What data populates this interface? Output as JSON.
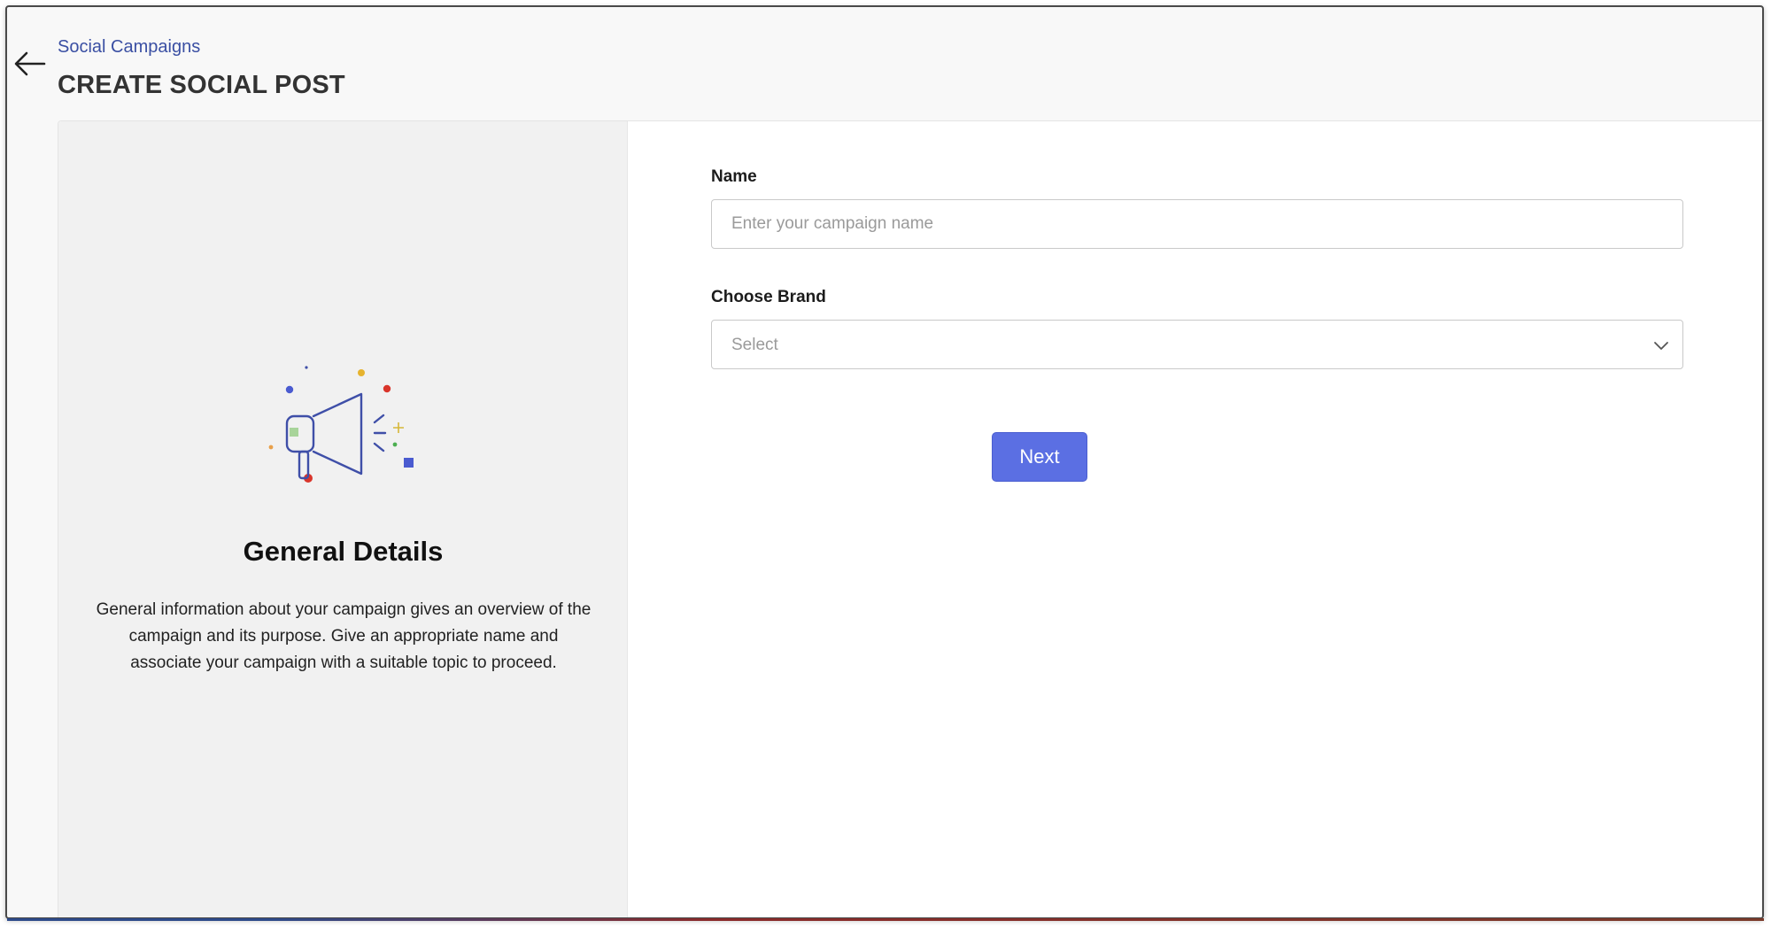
{
  "header": {
    "breadcrumb": "Social Campaigns",
    "title": "CREATE SOCIAL POST",
    "back_icon": "arrow-left-icon"
  },
  "left_panel": {
    "illustration_icon": "megaphone-icon",
    "title": "General Details",
    "description": "General information about your campaign gives an overview of the campaign and its purpose. Give an appropriate name and associate your campaign with a suitable topic to proceed."
  },
  "form": {
    "name_label": "Name",
    "name_value": "",
    "name_placeholder": "Enter your campaign name",
    "brand_label": "Choose Brand",
    "brand_selected": "Select",
    "brand_icon": "chevron-down-icon",
    "next_label": "Next"
  },
  "colors": {
    "accent": "#5b6fe3",
    "breadcrumb": "#3a4fa3",
    "illustration_line": "#3f4fa8"
  }
}
